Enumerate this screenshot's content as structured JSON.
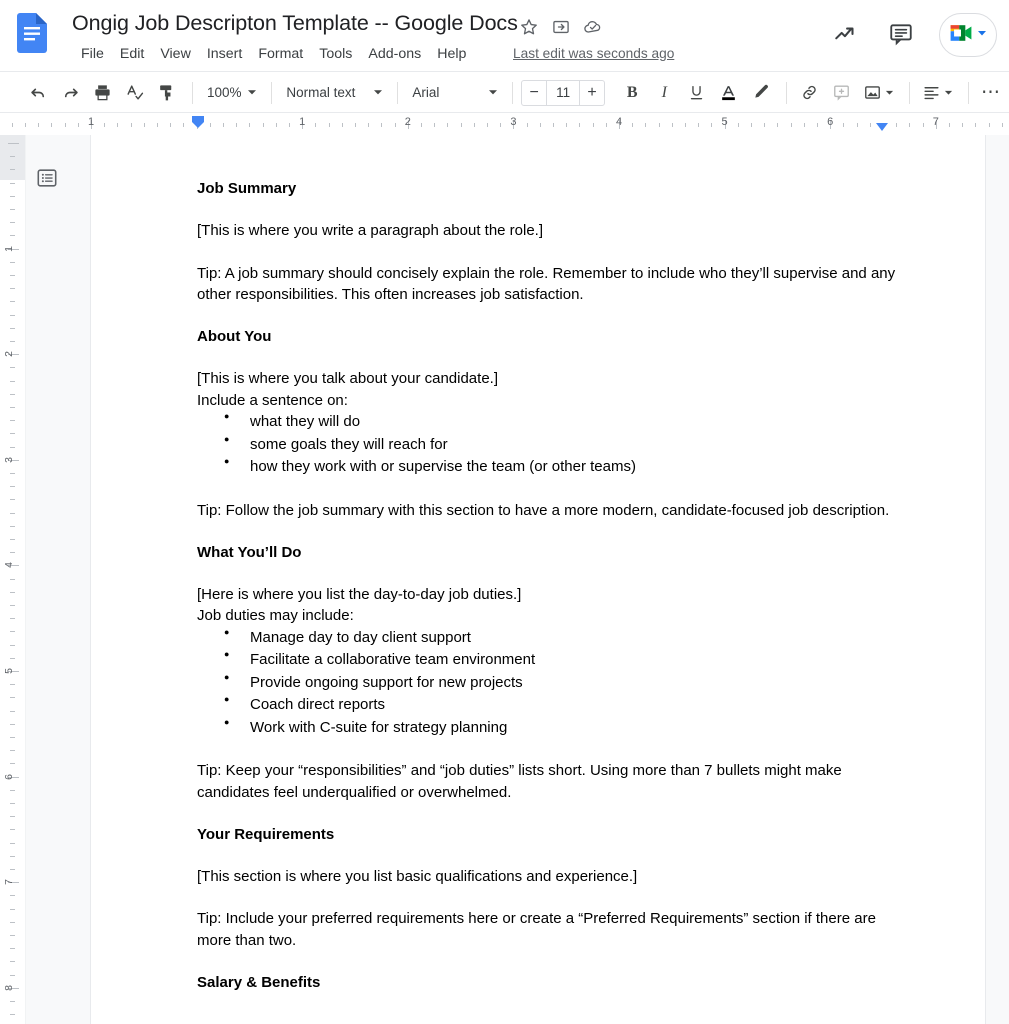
{
  "header": {
    "doc_title": "Ongig Job Descripton Template -- Google Docs",
    "logo_name": "google-docs-logo",
    "icons": {
      "star": "star-icon",
      "move_to_folder": "move-to-folder-icon",
      "cloud_saved": "cloud-saved-icon",
      "activity": "activity-trending-icon",
      "comment": "comment-icon",
      "meet": "google-meet-icon",
      "meet_chevron": "chevron-down-icon"
    },
    "last_edit": "Last edit was seconds ago",
    "menu": [
      {
        "label": "File"
      },
      {
        "label": "Edit"
      },
      {
        "label": "View"
      },
      {
        "label": "Insert"
      },
      {
        "label": "Format"
      },
      {
        "label": "Tools"
      },
      {
        "label": "Add-ons"
      },
      {
        "label": "Help"
      }
    ]
  },
  "toolbar": {
    "undo": "undo-icon",
    "redo": "redo-icon",
    "print": "print-icon",
    "spellcheck": "spellcheck-icon",
    "paint_format": "paint-format-icon",
    "zoom_value": "100%",
    "style_value": "Normal text",
    "font_value": "Arial",
    "font_size_value": "11",
    "font_size_decrease": "−",
    "font_size_increase": "+",
    "bold": "B",
    "italic": "I",
    "underline": "U",
    "text_color": "A",
    "highlight": "highlight-pen-icon",
    "link": "insert-link-icon",
    "add_comment": "add-comment-icon",
    "insert_image": "insert-image-icon",
    "align": "align-left-icon",
    "more": "⋯"
  },
  "ruler": {
    "horizontal_numbers": [
      "1",
      "1",
      "2",
      "3",
      "4",
      "5",
      "6",
      "7"
    ],
    "vertical_numbers": [
      "1",
      "2",
      "3",
      "4",
      "5",
      "6",
      "7",
      "8"
    ],
    "left_indent_marker": "left-indent-marker",
    "right_indent_marker": "right-indent-marker"
  },
  "sidebar": {
    "outline_button": "document-outline-button"
  },
  "document": {
    "blocks": [
      {
        "type": "heading",
        "text": "Job Summary"
      },
      {
        "type": "paragraph",
        "text": "[This is where you write a paragraph about the role.]"
      },
      {
        "type": "paragraph",
        "text": "Tip: A job summary should concisely explain the role. Remember to include who they’ll supervise and any other responsibilities. This often increases job satisfaction."
      },
      {
        "type": "heading",
        "text": "About You"
      },
      {
        "type": "paragraph",
        "text": "[This is where you talk about your candidate.]"
      },
      {
        "type": "paragraph",
        "text": "Include a sentence on:"
      },
      {
        "type": "bullets",
        "items": [
          "what they will do",
          "some goals they will reach for",
          "how they work with or supervise the team (or other teams)"
        ]
      },
      {
        "type": "paragraph",
        "text": "Tip: Follow the job summary with this section to have a more modern, candidate-focused job description."
      },
      {
        "type": "heading",
        "text": "What You’ll Do"
      },
      {
        "type": "paragraph",
        "text": "[Here is where you list the day-to-day job duties.]"
      },
      {
        "type": "paragraph",
        "text": "Job duties may include:"
      },
      {
        "type": "bullets",
        "items": [
          "Manage day to day client support",
          "Facilitate a collaborative team environment",
          "Provide ongoing support for new projects",
          "Coach direct reports",
          "Work with C-suite for strategy planning"
        ]
      },
      {
        "type": "paragraph",
        "text": "Tip: Keep your “responsibilities” and “job duties” lists short. Using more than 7 bullets might make candidates feel underqualified or overwhelmed."
      },
      {
        "type": "heading",
        "text": "Your Requirements"
      },
      {
        "type": "paragraph",
        "text": "[This section is where you list basic qualifications and experience.]"
      },
      {
        "type": "paragraph",
        "text": "Tip: Include your preferred requirements here or create a “Preferred Requirements” section if there are more than two."
      },
      {
        "type": "heading",
        "text": "Salary & Benefits"
      }
    ]
  },
  "colors": {
    "docs_blue": "#4285F4",
    "meet_green": "#00832D",
    "meet_yellow": "#FFBA00",
    "meet_red": "#EA4335",
    "meet_blue": "#2684FC",
    "text": "#202124",
    "muted": "#5f6368",
    "page_bg": "#f8f9fa"
  }
}
